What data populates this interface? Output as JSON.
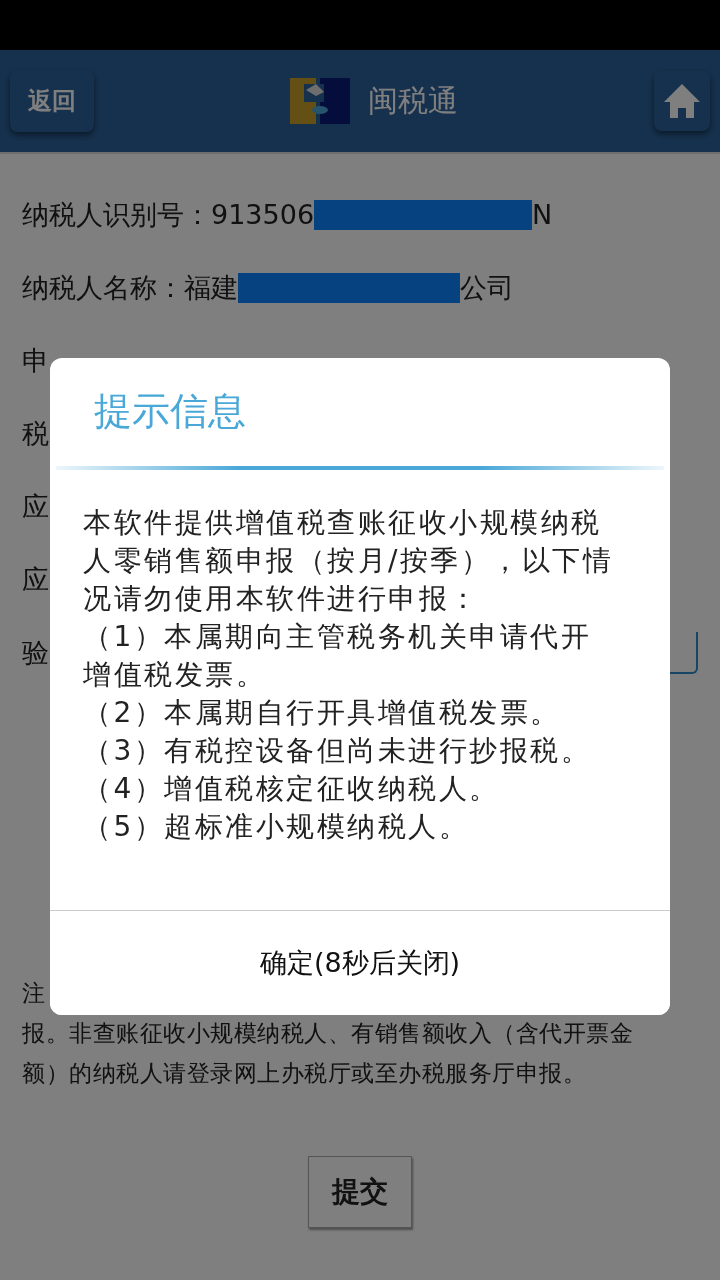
{
  "header": {
    "back_button": "返回",
    "title": "闽税通"
  },
  "form": {
    "rows": [
      {
        "kind": "redacted",
        "label": "纳税人识别号：",
        "prefix": "913506",
        "suffix": "N"
      },
      {
        "kind": "redacted",
        "label": "纳税人名称：",
        "prefix": "福建",
        "suffix": "公司"
      },
      {
        "kind": "text",
        "label": "申"
      },
      {
        "kind": "text",
        "label": "税"
      },
      {
        "kind": "text",
        "label": "应"
      },
      {
        "kind": "text",
        "label": "应"
      },
      {
        "kind": "input",
        "label": "验"
      }
    ],
    "note_lines": [
      "注",
      "报。非查账征收小规模纳税人、有销售额收入（含代开票金",
      "额）的纳税人请登录网上办税厅或至办税服务厅申报。"
    ],
    "submit_button": "提交"
  },
  "dialog": {
    "title": "提示信息",
    "intro": "本软件提供增值税查账征收小规模纳税人零销售额申报（按月/按季），以下情况请勿使用本软件进行申报：",
    "items": [
      "（1）本属期向主管税务机关申请代开增值税发票。",
      "（2）本属期自行开具增值税发票。",
      "（3）有税控设备但尚未进行抄报税。",
      "（4）增值税核定征收纳税人。",
      "（5）超标准小规模纳税人。"
    ],
    "confirm_button": "确定(8秒后关闭)"
  }
}
